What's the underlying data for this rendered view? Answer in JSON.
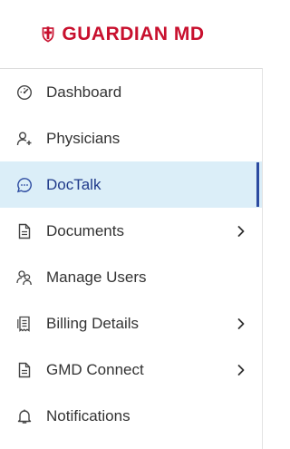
{
  "brand": {
    "name": "GUARDIAN MD",
    "color": "#c8102e"
  },
  "nav": {
    "active_index": 2,
    "items": [
      {
        "label": "Dashboard",
        "icon": "gauge-icon",
        "has_submenu": false
      },
      {
        "label": "Physicians",
        "icon": "user-plus-icon",
        "has_submenu": false
      },
      {
        "label": "DocTalk",
        "icon": "chat-bubble-icon",
        "has_submenu": false
      },
      {
        "label": "Documents",
        "icon": "document-icon",
        "has_submenu": true
      },
      {
        "label": "Manage Users",
        "icon": "users-icon",
        "has_submenu": false
      },
      {
        "label": "Billing Details",
        "icon": "receipt-icon",
        "has_submenu": true
      },
      {
        "label": "GMD Connect",
        "icon": "document-icon",
        "has_submenu": true
      },
      {
        "label": "Notifications",
        "icon": "bell-icon",
        "has_submenu": false
      }
    ]
  },
  "colors": {
    "active_bg": "#dbeef8",
    "active_bar": "#2b4aa0",
    "text": "#333333"
  }
}
